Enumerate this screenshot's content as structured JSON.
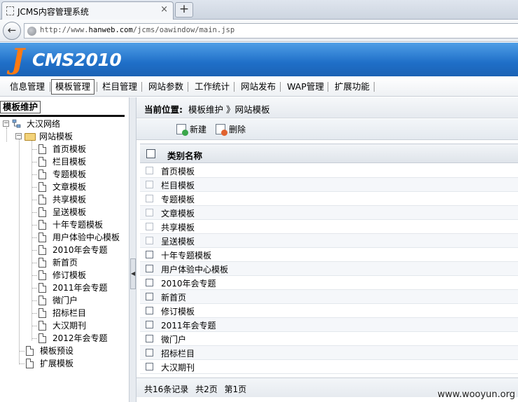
{
  "browser": {
    "tab_title": "JCMS内容管理系统",
    "tab_close": "×",
    "newtab_label": "+",
    "back_glyph": "←",
    "url_scheme": "http://www.",
    "url_host": "hanweb.com",
    "url_path": "/jcms/oawindow/main.jsp"
  },
  "header": {
    "logo_letter": "J",
    "logo_text": "CMS2010",
    "colors": {
      "header_blue": "#1f6fc8",
      "logo_orange": "#ff7a12"
    }
  },
  "menu": {
    "items": [
      "信息管理",
      "模板管理",
      "栏目管理",
      "网站参数",
      "工作统计",
      "网站发布",
      "WAP管理",
      "扩展功能"
    ],
    "active_index": 1
  },
  "left_panel": {
    "title": "模板维护",
    "tree": {
      "root": "大汉网络",
      "folder": "网站模板",
      "templates": [
        "首页模板",
        "栏目模板",
        "专题模板",
        "文章模板",
        "共享模板",
        "呈送模板",
        "十年专题模板",
        "用户体验中心模板",
        "2010年会专题",
        "新首页",
        "修订模板",
        "2011年会专题",
        "微门户",
        "招标栏目",
        "大汉期刊",
        "2012年会专题"
      ],
      "siblings": [
        "模板预设",
        "扩展模板"
      ]
    }
  },
  "right_panel": {
    "location_label": "当前位置:",
    "location_value": "模板维护 》网站模板",
    "toolbar": {
      "new_label": "新建",
      "delete_label": "删除"
    },
    "table": {
      "column_header": "类别名称",
      "rows": [
        "首页模板",
        "栏目模板",
        "专题模板",
        "文章模板",
        "共享模板",
        "呈送模板",
        "十年专题模板",
        "用户体验中心模板",
        "2010年会专题",
        "新首页",
        "修订模板",
        "2011年会专题",
        "微门户",
        "招标栏目",
        "大汉期刊"
      ]
    },
    "footer": "共16条记录 共2页 第1页"
  },
  "watermark": "www.wooyun.org"
}
